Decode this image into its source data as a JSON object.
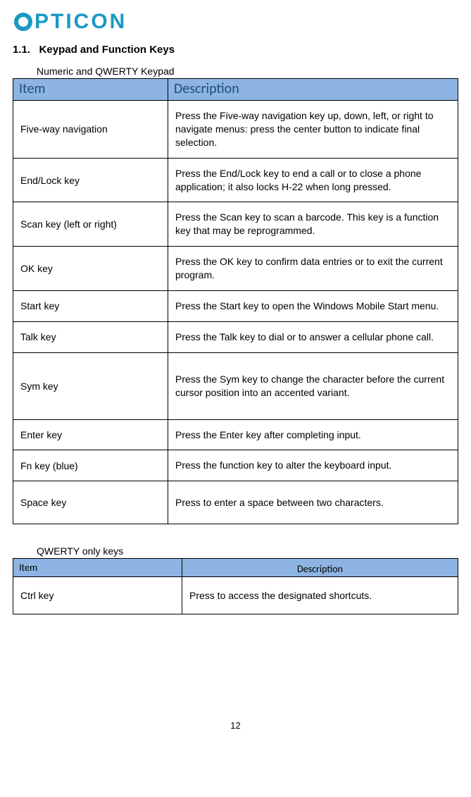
{
  "logo": {
    "text": "PTICON"
  },
  "section": {
    "number": "1.1.",
    "title": "Keypad and Function Keys"
  },
  "table1": {
    "label": "Numeric and QWERTY Keypad",
    "headers": {
      "item": "Item",
      "desc": "Description"
    },
    "rows": [
      {
        "item": "Five-way navigation",
        "desc": "Press the Five-way navigation key up, down, left, or right to navigate menus: press the center button to indicate final selection."
      },
      {
        "item": "End/Lock key",
        "desc": "Press the End/Lock key to end a call or to close a phone application; it also locks H-22 when long pressed."
      },
      {
        "item": "Scan key (left or right)",
        "desc": "Press the Scan key to scan a barcode. This key is a function key that may be reprogrammed."
      },
      {
        "item": "OK key",
        "desc": "Press the OK key to confirm data entries or to exit the current program."
      },
      {
        "item": "Start key",
        "desc": "Press the Start key to open the Windows Mobile Start menu."
      },
      {
        "item": "Talk key",
        "desc": "Press the Talk key to dial or to answer a cellular phone call."
      },
      {
        "item": "Sym key",
        "desc": "Press the Sym key to change the character before the current cursor position into an accented variant."
      },
      {
        "item": "Enter key",
        "desc": "Press the Enter key after completing input."
      },
      {
        "item": "Fn key (blue)",
        "desc": "Press the function key to alter the keyboard input."
      },
      {
        "item": "Space key",
        "desc": "Press to enter a space between two characters."
      }
    ]
  },
  "table2": {
    "label": "QWERTY only keys",
    "headers": {
      "item": "Item",
      "desc": "Description"
    },
    "rows": [
      {
        "item": "Ctrl key",
        "desc": "Press to access the designated shortcuts."
      }
    ]
  },
  "page_number": "12"
}
